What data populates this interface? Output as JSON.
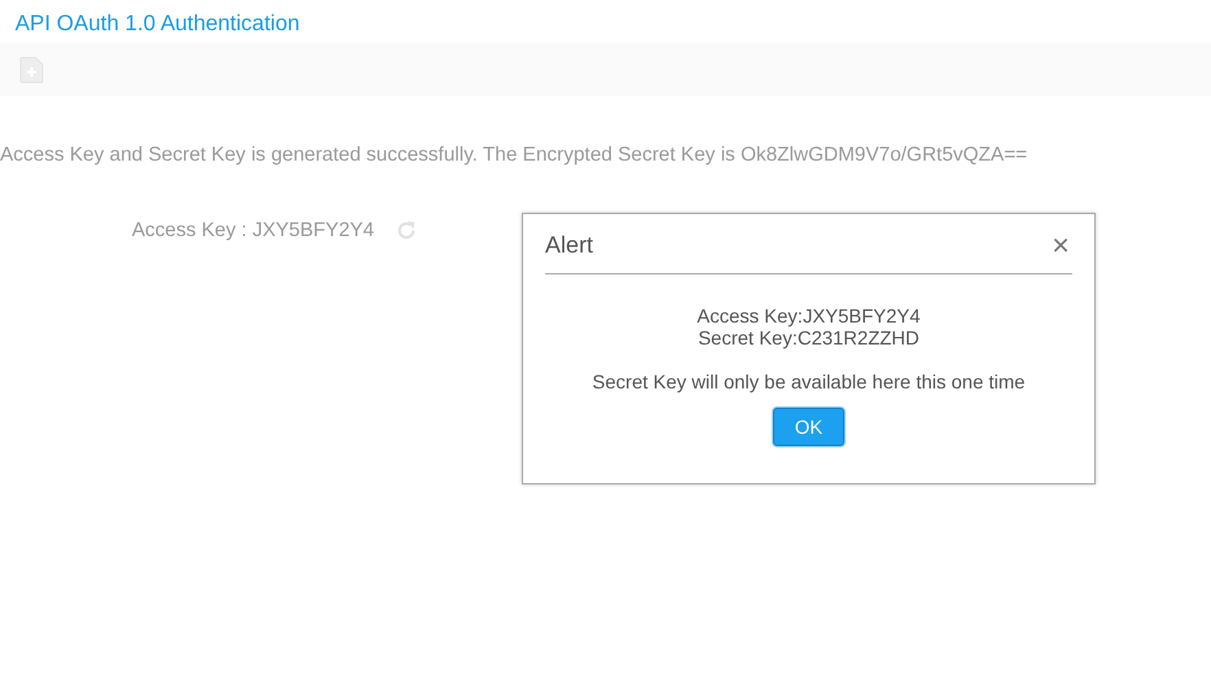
{
  "page": {
    "title": "API OAuth 1.0 Authentication"
  },
  "message": "Access Key and Secret Key is generated successfully. The Encrypted Secret Key is Ok8ZlwGDM9V7o/GRt5vQZA==",
  "access_key": "Access Key : JXY5BFY2Y4",
  "dialog": {
    "title": "Alert",
    "close": "×",
    "lines": [
      "Access Key:JXY5BFY2Y4",
      "Secret Key:C231R2ZZHD"
    ],
    "note": "Secret Key will only be available here this one time",
    "button": "OK"
  }
}
